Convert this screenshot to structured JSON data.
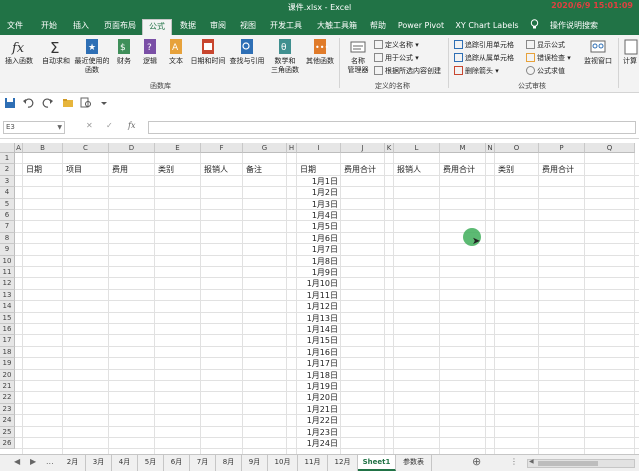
{
  "window": {
    "title": "课件.xlsx  -  Excel",
    "timestamp": "2020/6/9  15:01:09"
  },
  "tabs": [
    "文件",
    "开始",
    "插入",
    "页面布局",
    "公式",
    "数据",
    "审阅",
    "视图",
    "开发工具",
    "大触工具箱",
    "帮助",
    "Power Pivot",
    "XY Chart Labels",
    "操作说明搜索"
  ],
  "active_tab": "公式",
  "ribbon": {
    "insert_function": "插入函数",
    "autosum": "自动求和",
    "recent_line1": "最近使用的",
    "recent_line2": "函数",
    "financial": "财务",
    "logical": "逻辑",
    "text": "文本",
    "datetime": "日期和时间",
    "lookup": "查找与引用",
    "math_line1": "数学和",
    "math_line2": "三角函数",
    "more": "其他函数",
    "group_library": "函数库",
    "name_manager_line1": "名称",
    "name_manager_line2": "管理器",
    "define_name": "定义名称",
    "use_in_formula": "用于公式",
    "create_from_selection": "根据所选内容创建",
    "group_names": "定义的名称",
    "trace_precedents": "追踪引用单元格",
    "trace_dependents": "追踪从属单元格",
    "remove_arrows": "删除箭头",
    "show_formulas": "显示公式",
    "error_checking": "错误检查",
    "evaluate_formula": "公式求值",
    "group_audit": "公式审核",
    "watch_window": "监视窗口",
    "calc_partial": "计算"
  },
  "formula_bar": {
    "namebox": "E3",
    "fx": "fx",
    "cancel": "✕",
    "enter": "✓",
    "content": ""
  },
  "columns": [
    "A",
    "B",
    "C",
    "D",
    "E",
    "F",
    "G",
    "H",
    "I",
    "J",
    "K",
    "L",
    "M",
    "N",
    "O",
    "P",
    "Q"
  ],
  "rows": [
    "1",
    "2",
    "3",
    "4",
    "5",
    "6",
    "7",
    "8",
    "9",
    "10",
    "11",
    "12",
    "13",
    "14",
    "15",
    "16",
    "17",
    "18",
    "19",
    "20",
    "21",
    "22",
    "23",
    "24",
    "25",
    "26"
  ],
  "header_row": {
    "B": "日期",
    "C": "项目",
    "D": "费用",
    "E": "类别",
    "F": "报销人",
    "G": "备注",
    "I": "日期",
    "J": "费用合计",
    "L": "报销人",
    "M": "费用合计",
    "O": "类别",
    "P": "费用合计"
  },
  "dates": [
    "1月1日",
    "1月2日",
    "1月3日",
    "1月4日",
    "1月5日",
    "1月6日",
    "1月7日",
    "1月8日",
    "1月9日",
    "1月10日",
    "1月11日",
    "1月12日",
    "1月13日",
    "1月14日",
    "1月15日",
    "1月16日",
    "1月17日",
    "1月18日",
    "1月19日",
    "1月20日",
    "1月21日",
    "1月22日",
    "1月23日",
    "1月24日"
  ],
  "sheets": [
    "2月",
    "3月",
    "4月",
    "5月",
    "6月",
    "7月",
    "8月",
    "9月",
    "10月",
    "11月",
    "12月",
    "Sheet1",
    "参数表"
  ],
  "active_sheet": "Sheet1",
  "sheet_nav": {
    "prev": "◀",
    "next": "▶",
    "more": "...",
    "add": "⊕",
    "more_right": "⋮",
    "scroll_left": "◀"
  },
  "colors": {
    "accent": "#217346",
    "timestamp": "#e04040",
    "cursor": "#3fae5a"
  }
}
